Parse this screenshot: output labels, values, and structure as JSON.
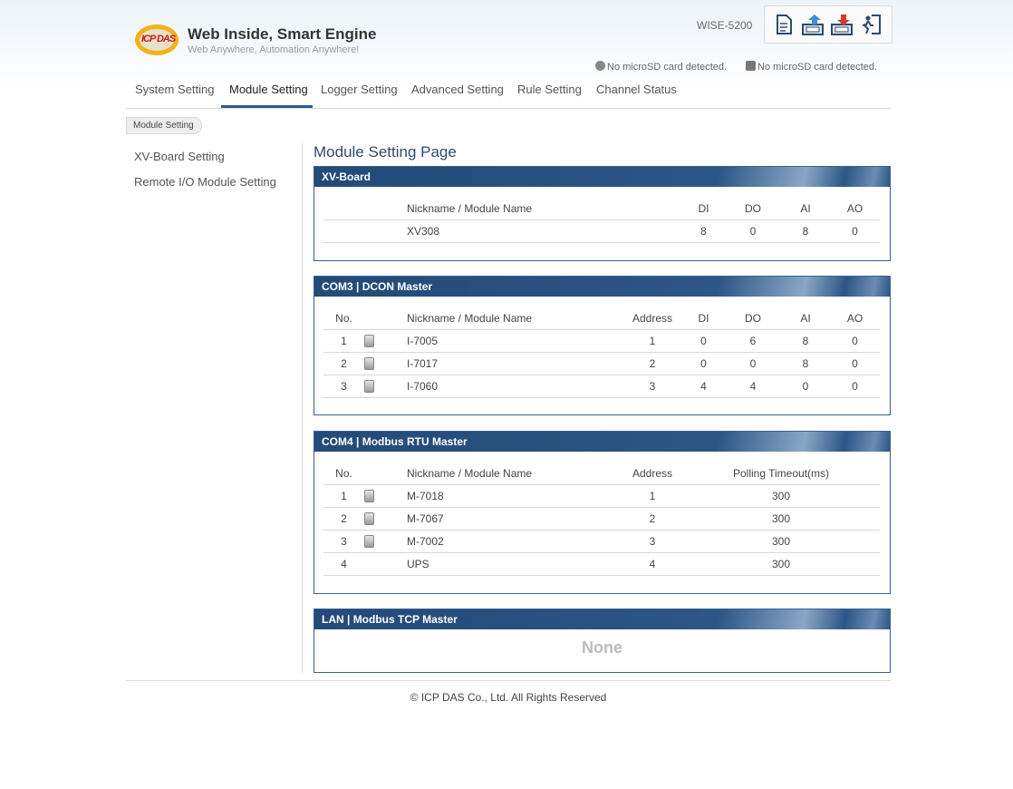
{
  "header": {
    "logo_text": "ICP DAS",
    "title": "Web Inside, Smart Engine",
    "subtitle": "Web Anywhere, Automation Anywhere!",
    "model": "WISE-5200",
    "sd_status_1": "No microSD card detected.",
    "sd_status_2": "No microSD card detected."
  },
  "nav": {
    "items": [
      "System Setting",
      "Module Setting",
      "Logger Setting",
      "Advanced Setting",
      "Rule Setting",
      "Channel Status"
    ],
    "active": "Module Setting"
  },
  "breadcrumb": "Module Setting",
  "sidebar": {
    "items": [
      "XV-Board Setting",
      "Remote I/O Module Setting"
    ]
  },
  "main": {
    "title": "Module Setting Page",
    "xv_board": {
      "title": "XV-Board",
      "headers": [
        "Nickname / Module Name",
        "DI",
        "DO",
        "AI",
        "AO"
      ],
      "rows": [
        [
          "XV308",
          "8",
          "0",
          "8",
          "0"
        ]
      ]
    },
    "com3": {
      "title": "COM3 | DCON Master",
      "headers": [
        "No.",
        "Nickname / Module Name",
        "Address",
        "DI",
        "DO",
        "AI",
        "AO"
      ],
      "rows": [
        [
          "1",
          "I-7005",
          "1",
          "0",
          "6",
          "8",
          "0"
        ],
        [
          "2",
          "I-7017",
          "2",
          "0",
          "0",
          "8",
          "0"
        ],
        [
          "3",
          "I-7060",
          "3",
          "4",
          "4",
          "0",
          "0"
        ]
      ]
    },
    "com4": {
      "title": "COM4 | Modbus RTU Master",
      "headers": [
        "No.",
        "Nickname / Module Name",
        "Address",
        "Polling Timeout(ms)"
      ],
      "rows": [
        [
          "1",
          "M-7018",
          "1",
          "300"
        ],
        [
          "2",
          "M-7067",
          "2",
          "300"
        ],
        [
          "3",
          "M-7002",
          "3",
          "300"
        ],
        [
          "4",
          "UPS",
          "4",
          "300"
        ]
      ]
    },
    "lan": {
      "title": "LAN | Modbus TCP Master",
      "empty_text": "None"
    }
  },
  "footer": "© ICP DAS Co., Ltd. All Rights Reserved",
  "icons": [
    "logo-image",
    "document-icon",
    "upload-icon",
    "download-icon",
    "logout-icon",
    "module-icon"
  ],
  "colors": {
    "accent": "#2f5b8e",
    "panel_header": "#2c5686"
  }
}
